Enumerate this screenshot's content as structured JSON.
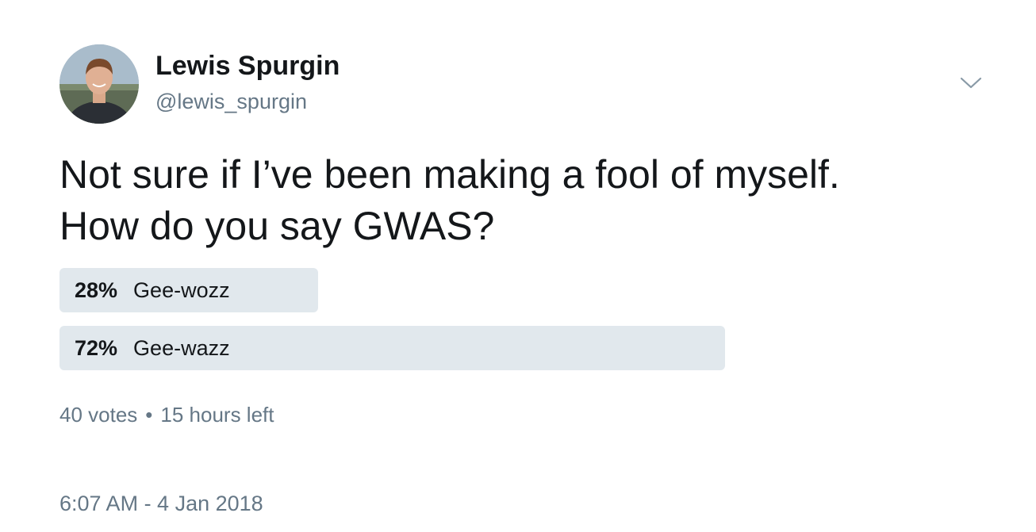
{
  "author": {
    "name": "Lewis Spurgin",
    "handle": "@lewis_spurgin"
  },
  "tweet": {
    "text_lines": [
      "Not sure if I’ve been making a fool of myself.",
      "How do you say GWAS?"
    ]
  },
  "poll": {
    "options": [
      {
        "percent_label": "28%",
        "percent": 28,
        "label": "Gee-wozz"
      },
      {
        "percent_label": "72%",
        "percent": 72,
        "label": "Gee-wazz"
      }
    ],
    "votes": "40 votes",
    "separator": "•",
    "time_left": "15 hours left"
  },
  "timestamp": "6:07 AM - 4 Jan 2018",
  "icons": {
    "menu": "chevron-down-icon"
  },
  "colors": {
    "text_primary": "#14171a",
    "text_secondary": "#657786",
    "poll_bar": "#e1e8ed"
  }
}
